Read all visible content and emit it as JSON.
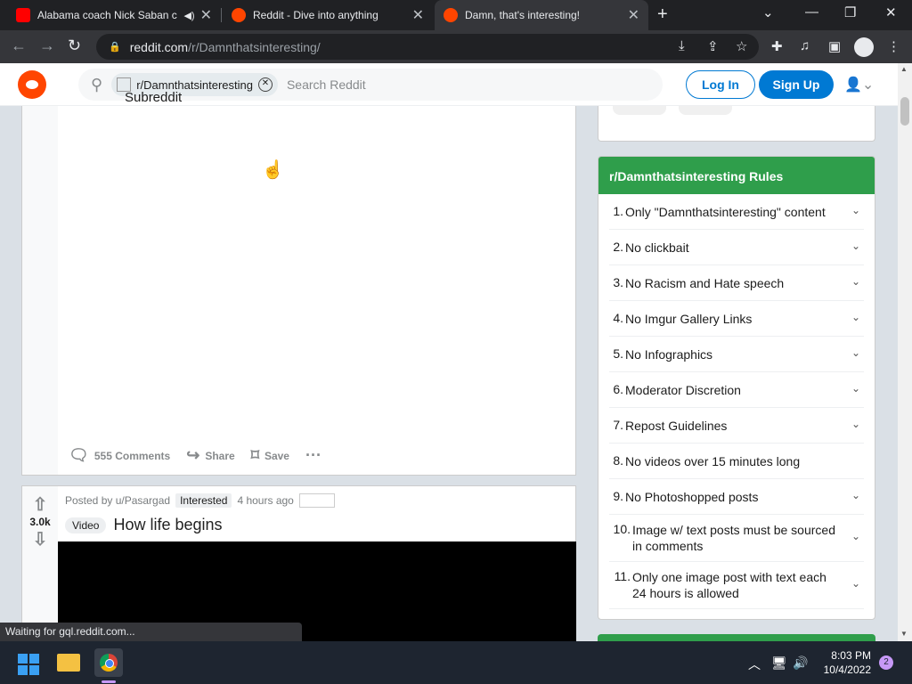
{
  "browser": {
    "tabs": [
      {
        "title": "Alabama coach Nick Saban c",
        "favicon": "youtube-icon",
        "color": "#ff0000",
        "muted_icon": "speaker-icon"
      },
      {
        "title": "Reddit - Dive into anything",
        "favicon": "reddit-icon",
        "color": "#ff4500"
      },
      {
        "title": "Damn, that's interesting!",
        "favicon": "reddit-icon",
        "color": "#ff4500",
        "active": true
      }
    ],
    "new_tab": "+",
    "url_host": "reddit.com",
    "url_path": "/r/Damnthatsinteresting/"
  },
  "reddit_header": {
    "search_chip": "r/Damnthatsinteresting",
    "search_placeholder": "Search Reddit",
    "subreddit_icon_alt": "Subreddit Icon",
    "login": "Log In",
    "signup": "Sign Up"
  },
  "post1": {
    "comments": "555 Comments",
    "share": "Share",
    "save": "Save"
  },
  "post2": {
    "score": "3.0k",
    "posted_by": "Posted by u/Pasargad",
    "user_flair": "Interested",
    "time": "4 hours ago",
    "post_flair": "Video",
    "title": "How life begins"
  },
  "rules": {
    "header": "r/Damnthatsinteresting Rules",
    "accent": "#2f9e4b",
    "items": [
      {
        "num": "1.",
        "text": "Only \"Damnthatsinteresting\" content",
        "expandable": true
      },
      {
        "num": "2.",
        "text": "No clickbait",
        "expandable": true
      },
      {
        "num": "3.",
        "text": "No Racism and Hate speech",
        "expandable": true
      },
      {
        "num": "4.",
        "text": "No Imgur Gallery Links",
        "expandable": true
      },
      {
        "num": "5.",
        "text": "No Infographics",
        "expandable": true
      },
      {
        "num": "6.",
        "text": "Moderator Discretion",
        "expandable": true
      },
      {
        "num": "7.",
        "text": "Repost Guidelines",
        "expandable": true
      },
      {
        "num": "8.",
        "text": "No videos over 15 minutes long",
        "expandable": false
      },
      {
        "num": "9.",
        "text": "No Photoshopped posts",
        "expandable": true
      },
      {
        "num": "10.",
        "text": "Image w/ text posts must be sourced in comments",
        "expandable": true
      },
      {
        "num": "11.",
        "text": "Only one image post with text each 24 hours is allowed",
        "expandable": true
      }
    ]
  },
  "status_text": "Waiting for gql.reddit.com...",
  "taskbar": {
    "time": "8:03 PM",
    "date": "10/4/2022",
    "notifications": "2"
  }
}
